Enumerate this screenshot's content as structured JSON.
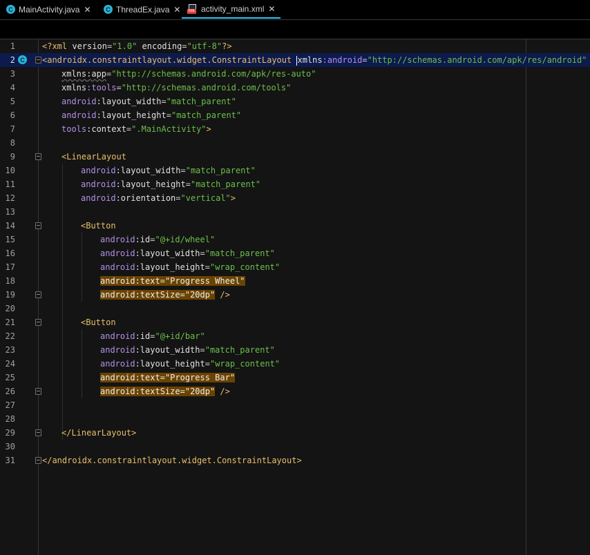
{
  "tabs": [
    {
      "label": "MainActivity.java",
      "icon": "class-c-icon",
      "active": false
    },
    {
      "label": "ThreadEx.java",
      "icon": "class-c-icon",
      "active": false
    },
    {
      "label": "activity_main.xml",
      "icon": "xml-file-icon",
      "active": true
    }
  ],
  "colors": {
    "accent": "#31c5f4",
    "string": "#6cbf4b",
    "namespace": "#b391e8",
    "tag": "#e8bf6a",
    "highlight": "#6b4300",
    "current_line": "#0d1a4d"
  },
  "editor": {
    "current_line": 2,
    "lines": [
      {
        "n": "1",
        "pi": "<?xml ",
        "a1": "version",
        "s1": "\"1.0\"",
        "a2": " encoding",
        "s2": "\"utf-8\"",
        "end": "?>"
      },
      {
        "n": "2",
        "tag": "<androidx.constraintlayout.widget.ConstraintLayout ",
        "ns": "xmlns",
        "attr": ":android",
        "str": "\"http://schemas.android.com/apk/res/android\""
      },
      {
        "n": "3",
        "ns": "xmlns",
        "attr": ":app",
        "str": "\"http://schemas.android.com/apk/res-auto\""
      },
      {
        "n": "4",
        "ns": "xmlns",
        "attr": ":tools",
        "str": "\"http://schemas.android.com/tools\""
      },
      {
        "n": "5",
        "ns": "android",
        "attr": ":layout_width",
        "str": "\"match_parent\""
      },
      {
        "n": "6",
        "ns": "android",
        "attr": ":layout_height",
        "str": "\"match_parent\""
      },
      {
        "n": "7",
        "ns": "tools",
        "attr": ":context",
        "str": "\".MainActivity\"",
        "end": ">"
      },
      {
        "n": "8"
      },
      {
        "n": "9",
        "tag": "<LinearLayout"
      },
      {
        "n": "10",
        "ns": "android",
        "attr": ":layout_width",
        "str": "\"match_parent\""
      },
      {
        "n": "11",
        "ns": "android",
        "attr": ":layout_height",
        "str": "\"match_parent\""
      },
      {
        "n": "12",
        "ns": "android",
        "attr": ":orientation",
        "str": "\"vertical\"",
        "end": ">"
      },
      {
        "n": "13"
      },
      {
        "n": "14",
        "tag": "<Button"
      },
      {
        "n": "15",
        "ns": "android",
        "attr": ":id",
        "str": "\"@+id/wheel\""
      },
      {
        "n": "16",
        "ns": "android",
        "attr": ":layout_width",
        "str": "\"match_parent\""
      },
      {
        "n": "17",
        "ns": "android",
        "attr": ":layout_height",
        "str": "\"wrap_content\""
      },
      {
        "n": "18",
        "ns": "android",
        "attr": ":text",
        "str": "\"Progress Wheel\""
      },
      {
        "n": "19",
        "ns": "android",
        "attr": ":textSize",
        "str": "\"20dp\"",
        "end": " />"
      },
      {
        "n": "20"
      },
      {
        "n": "21",
        "tag": "<Button"
      },
      {
        "n": "22",
        "ns": "android",
        "attr": ":id",
        "str": "\"@+id/bar\""
      },
      {
        "n": "23",
        "ns": "android",
        "attr": ":layout_width",
        "str": "\"match_parent\""
      },
      {
        "n": "24",
        "ns": "android",
        "attr": ":layout_height",
        "str": "\"wrap_content\""
      },
      {
        "n": "25",
        "ns": "android",
        "attr": ":text",
        "str": "\"Progress Bar\""
      },
      {
        "n": "26",
        "ns": "android",
        "attr": ":textSize",
        "str": "\"20dp\"",
        "end": " />"
      },
      {
        "n": "27"
      },
      {
        "n": "28"
      },
      {
        "n": "29",
        "tag": "</LinearLayout>"
      },
      {
        "n": "30"
      },
      {
        "n": "31",
        "tag": "</androidx.constraintlayout.widget.ConstraintLayout>"
      }
    ]
  }
}
